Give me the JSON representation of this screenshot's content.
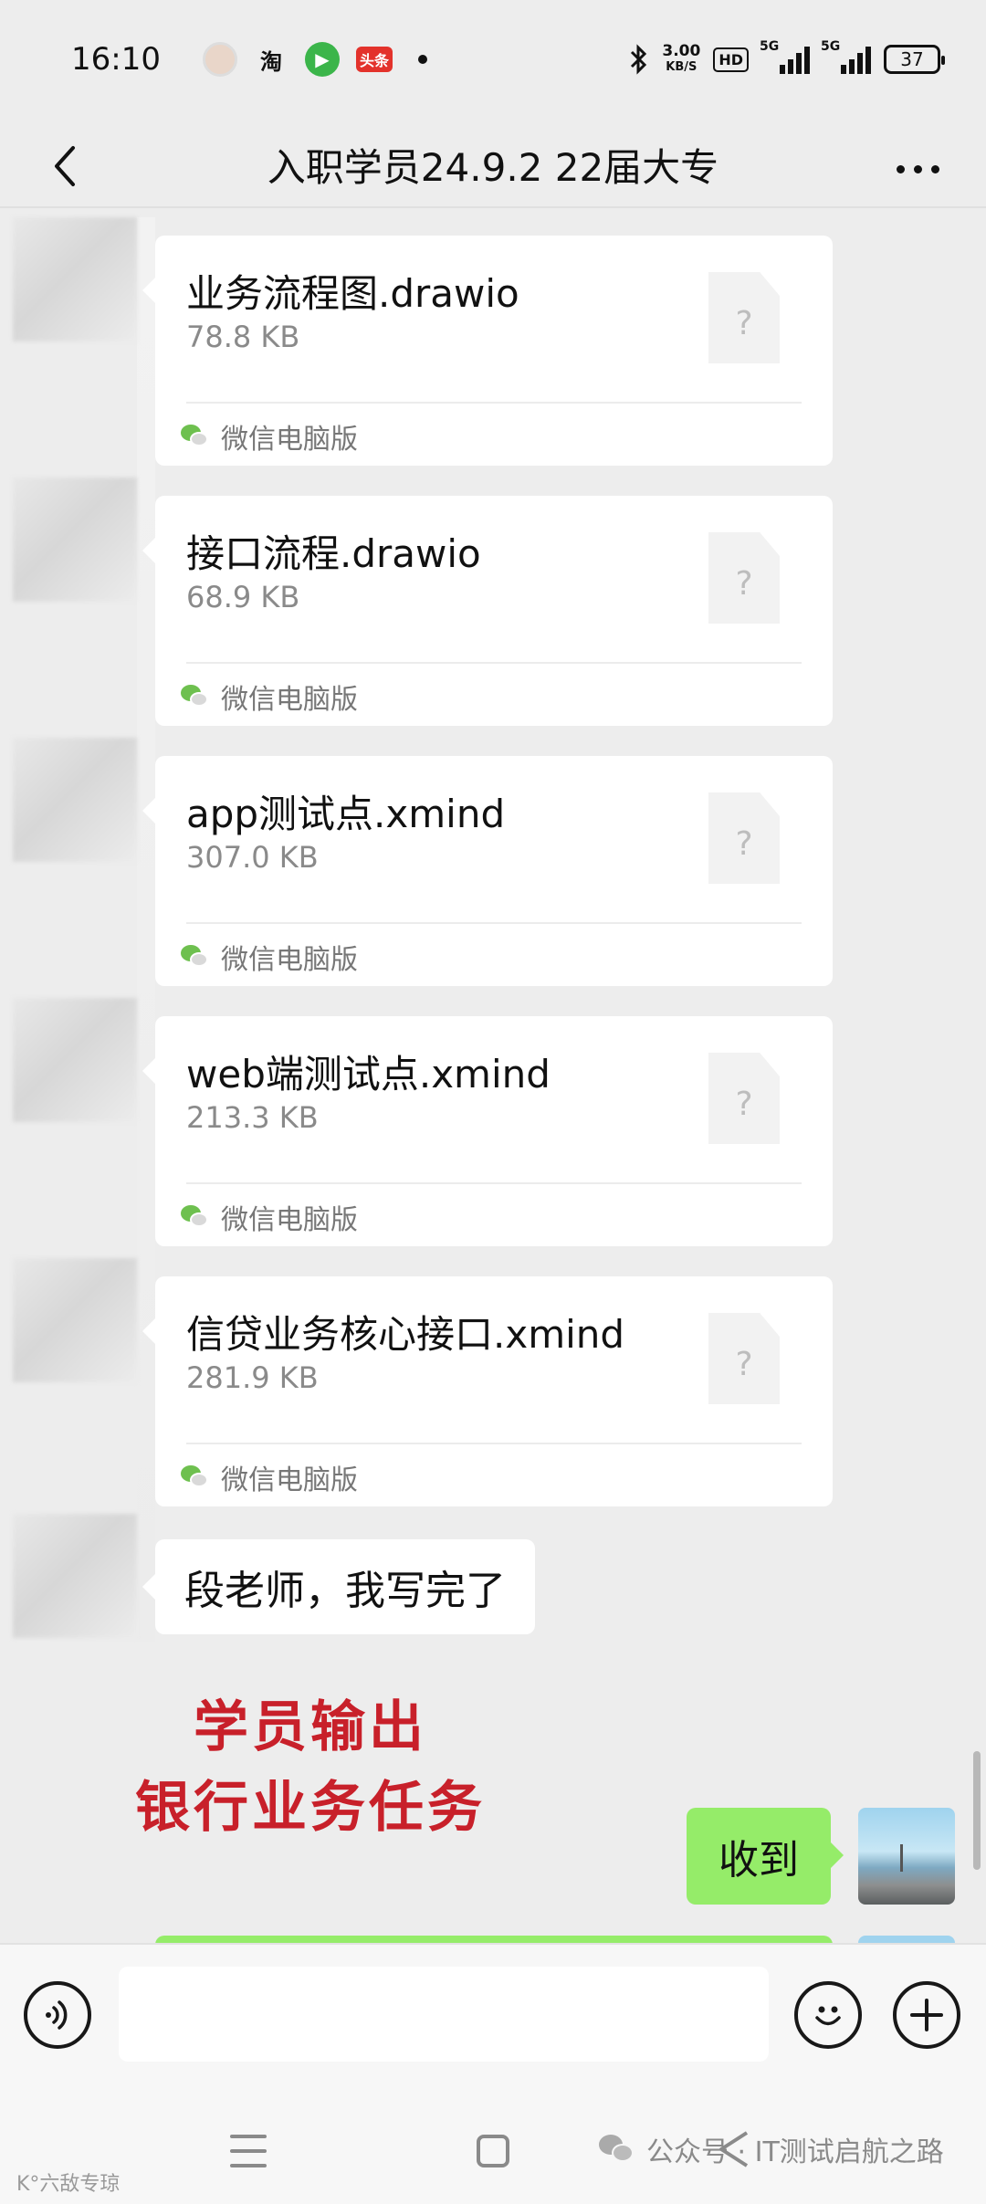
{
  "status_bar": {
    "time": "16:10",
    "app_icons": [
      "avatar",
      "淘",
      "video",
      "头条"
    ],
    "network_speed_value": "3.00",
    "network_speed_unit": "KB/S",
    "hd_label": "HD",
    "signal_1_label": "5G",
    "signal_2_label": "5G",
    "battery_level": "37"
  },
  "header": {
    "title": "入职学员24.9.2 22届大专"
  },
  "messages": {
    "files": [
      {
        "name": "业务流程图.drawio",
        "size": "78.8 KB",
        "source": "微信电脑版"
      },
      {
        "name": "接口流程.drawio",
        "size": "68.9 KB",
        "source": "微信电脑版"
      },
      {
        "name": "app测试点.xmind",
        "size": "307.0 KB",
        "source": "微信电脑版"
      },
      {
        "name": "web端测试点.xmind",
        "size": "213.3 KB",
        "source": "微信电脑版"
      },
      {
        "name": "信贷业务核心接口.xmind",
        "size": "281.9 KB",
        "source": "微信电脑版"
      }
    ],
    "file_icon_glyph": "?",
    "text_message": "段老师，我写完了",
    "reply": "收到"
  },
  "overlay_caption": {
    "line1": "学员输出",
    "line2": "银行业务任务"
  },
  "watermarks": {
    "left": "K°六敌专琼",
    "right": "公众号 · IT测试启航之路"
  },
  "colors": {
    "chat_background": "#ededed",
    "reply_bubble": "#95ec69",
    "caption_red": "#c8202a",
    "wechat_green": "#6ec04f"
  }
}
